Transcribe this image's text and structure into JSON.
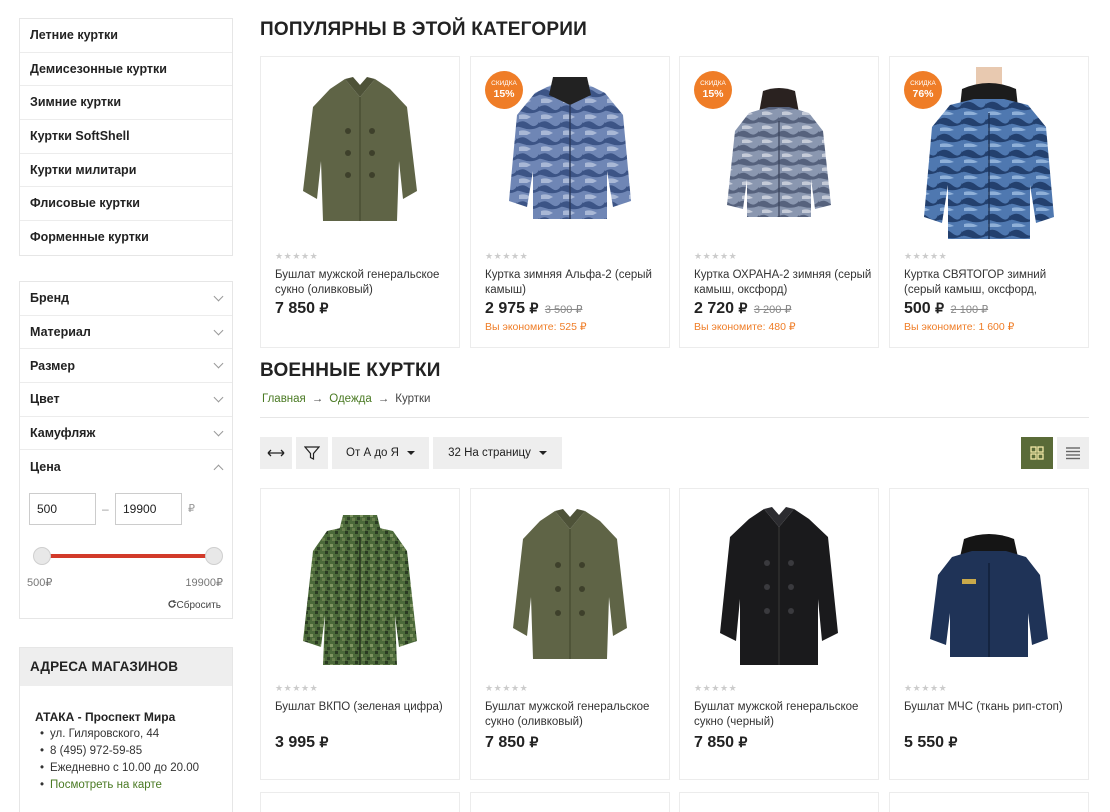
{
  "categories": [
    "Летние куртки",
    "Демисезонные куртки",
    "Зимние куртки",
    "Куртки SoftShell",
    "Куртки милитари",
    "Флисовые куртки",
    "Форменные куртки"
  ],
  "filters": {
    "items": [
      "Бренд",
      "Материал",
      "Размер",
      "Цвет",
      "Камуфляж",
      "Цена"
    ],
    "price_min": "500",
    "price_max": "19900",
    "dash": "–",
    "currency": "₽",
    "slider_min_label": "500₽",
    "slider_max_label": "19900₽",
    "slider_range": [
      0,
      1
    ],
    "reset": "Сбросить"
  },
  "stores": {
    "title": "АДРЕСА МАГАЗИНОВ",
    "name": "АТАКА - Проспект Мира",
    "address": "ул. Гиляровского, 44",
    "phone": "8 (495) 972-59-85",
    "hours": "Ежедневно с 10.00 до 20.00",
    "map_link": "Посмотреть на карте"
  },
  "popular": {
    "title": "ПОПУЛЯРНЫ В ЭТОЙ КАТЕГОРИИ",
    "products": [
      {
        "name": "Бушлат мужской генеральское сукно (оливковый)",
        "price": "7 850",
        "old_price": "",
        "save": "",
        "badge_label": "",
        "badge_value": "",
        "stars": "★★★★★"
      },
      {
        "name": "Куртка зимняя Альфа-2 (серый камыш)",
        "price": "2 975",
        "old_price": "3 500 ₽",
        "save": "Вы экономите: 525 ₽",
        "badge_label": "СКИДКА",
        "badge_value": "15%",
        "stars": "★★★★★"
      },
      {
        "name": "Куртка ОХРАНА-2 зимняя (серый камыш, оксфорд)",
        "price": "2 720",
        "old_price": "3 200 ₽",
        "save": "Вы экономите: 480 ₽",
        "badge_label": "СКИДКА",
        "badge_value": "15%",
        "stars": "★★★★★"
      },
      {
        "name": "Куртка СВЯТОГОР зимний (серый камыш, оксфорд,",
        "price": "500",
        "old_price": "2 100 ₽",
        "save": "Вы экономите: 1 600 ₽",
        "badge_label": "СКИДКА",
        "badge_value": "76%",
        "stars": "★★★★★"
      }
    ]
  },
  "catalog": {
    "title": "ВОЕННЫЕ КУРТКИ",
    "breadcrumb": [
      "Главная",
      "Одежда",
      "Куртки"
    ],
    "breadcrumb_sep": "→",
    "sort_label": "От А до Я",
    "per_page_label": "32 На страницу",
    "currency": "₽",
    "products": [
      {
        "name": "Бушлат ВКПО (зеленая цифра)",
        "price": "3 995",
        "stars": "★★★★★"
      },
      {
        "name": "Бушлат мужской генеральское сукно (оливковый)",
        "price": "7 850",
        "stars": "★★★★★"
      },
      {
        "name": "Бушлат мужской генеральское сукно (черный)",
        "price": "7 850",
        "stars": "★★★★★"
      },
      {
        "name": "Бушлат МЧС (ткань рип-стоп)",
        "price": "5 550",
        "stars": "★★★★★"
      }
    ]
  },
  "colors": {
    "accent_green": "#5a6b38",
    "discount_orange": "#ef7d27",
    "slider_red": "#d23a2a",
    "link_green": "#4a7a23"
  },
  "icons": [
    "chevron-down-icon",
    "chevron-up-icon",
    "reset-icon",
    "expand-horizontal-icon",
    "filter-funnel-icon",
    "caret-down-icon",
    "grid-view-icon",
    "list-view-icon"
  ]
}
